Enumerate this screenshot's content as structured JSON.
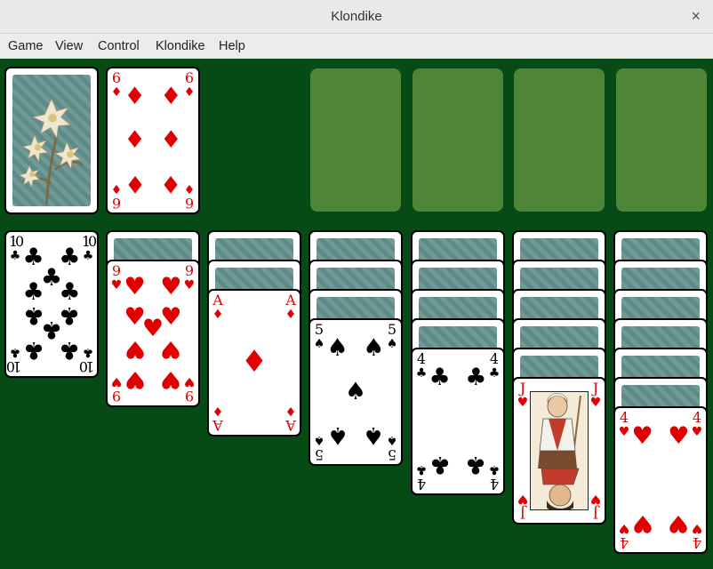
{
  "window": {
    "title": "Klondike",
    "close_glyph": "×"
  },
  "menu": {
    "items": [
      "Game",
      "View",
      "Control",
      "Klondike",
      "Help"
    ]
  },
  "colors": {
    "felt": "#064b16",
    "slot": "#4f8536",
    "red_suit": "#e00000"
  },
  "stock": {
    "face_down": true,
    "image": "edelweiss-card-back"
  },
  "waste": {
    "top": {
      "rank": "6",
      "suit": "♦"
    }
  },
  "foundations": [
    {
      "empty": true
    },
    {
      "empty": true
    },
    {
      "empty": true
    },
    {
      "empty": true
    }
  ],
  "tableau": [
    {
      "hidden": 0,
      "face_up": [
        {
          "rank": "10",
          "suit": "♣"
        }
      ]
    },
    {
      "hidden": 1,
      "face_up": [
        {
          "rank": "9",
          "suit": "♥"
        }
      ]
    },
    {
      "hidden": 2,
      "face_up": [
        {
          "rank": "A",
          "suit": "♦"
        }
      ]
    },
    {
      "hidden": 3,
      "face_up": [
        {
          "rank": "5",
          "suit": "♠"
        }
      ]
    },
    {
      "hidden": 4,
      "face_up": [
        {
          "rank": "4",
          "suit": "♣"
        }
      ]
    },
    {
      "hidden": 5,
      "face_up": [
        {
          "rank": "J",
          "suit": "♥"
        }
      ]
    },
    {
      "hidden": 6,
      "face_up": [
        {
          "rank": "4",
          "suit": "♥"
        }
      ]
    }
  ]
}
